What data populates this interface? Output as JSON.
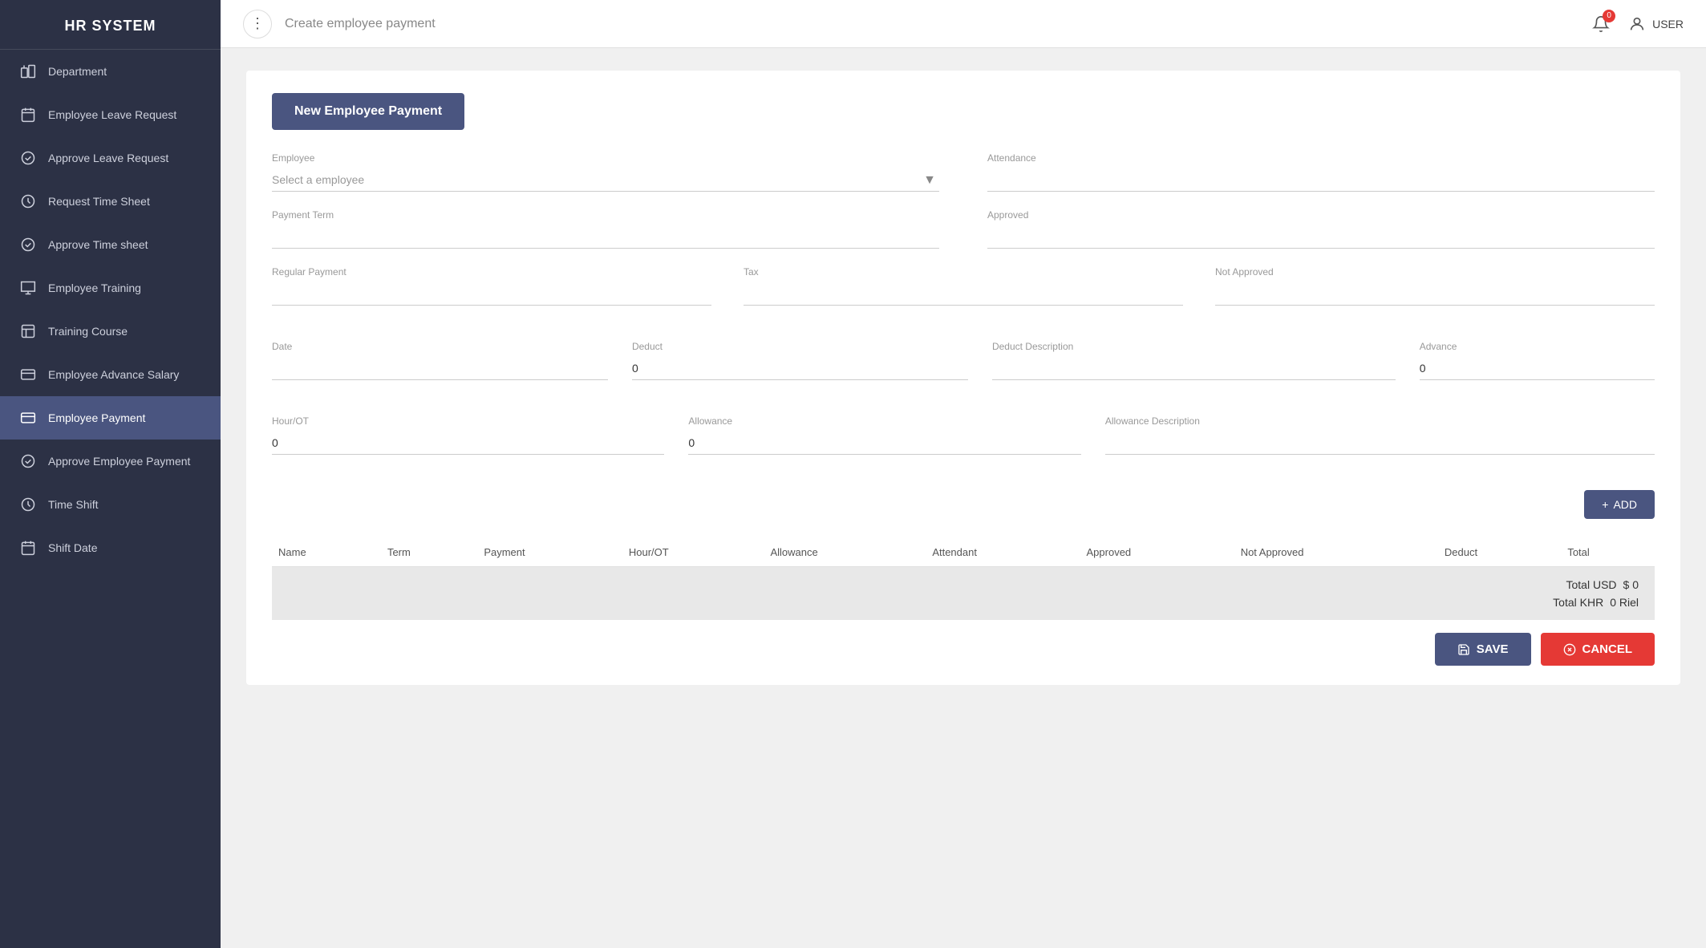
{
  "app": {
    "title": "HR SYSTEM"
  },
  "topbar": {
    "page_title": "Create employee payment",
    "notification_count": "0",
    "user_label": "USER"
  },
  "sidebar": {
    "items": [
      {
        "id": "department",
        "label": "Department",
        "icon": "department-icon",
        "active": false
      },
      {
        "id": "employee-leave-request",
        "label": "Employee Leave Request",
        "icon": "leave-icon",
        "active": false
      },
      {
        "id": "approve-leave-request",
        "label": "Approve Leave Request",
        "icon": "approve-icon",
        "active": false
      },
      {
        "id": "request-time-sheet",
        "label": "Request Time Sheet",
        "icon": "clock-icon",
        "active": false
      },
      {
        "id": "approve-time-sheet",
        "label": "Approve Time sheet",
        "icon": "approve2-icon",
        "active": false
      },
      {
        "id": "employee-training",
        "label": "Employee Training",
        "icon": "training-icon",
        "active": false
      },
      {
        "id": "training-course",
        "label": "Training Course",
        "icon": "course-icon",
        "active": false
      },
      {
        "id": "employee-advance-salary",
        "label": "Employee Advance Salary",
        "icon": "salary-icon",
        "active": false
      },
      {
        "id": "employee-payment",
        "label": "Employee Payment",
        "icon": "payment-icon",
        "active": true
      },
      {
        "id": "approve-employee-payment",
        "label": "Approve Employee Payment",
        "icon": "approve3-icon",
        "active": false
      },
      {
        "id": "time-shift",
        "label": "Time Shift",
        "icon": "timeshift-icon",
        "active": false
      },
      {
        "id": "shift-date",
        "label": "Shift Date",
        "icon": "shiftdate-icon",
        "active": false
      }
    ]
  },
  "form": {
    "header_btn": "New Employee Payment",
    "employee_label": "Employee",
    "employee_placeholder": "Select a employee",
    "attendance_label": "Attendance",
    "attendance_value": "",
    "payment_term_label": "Payment Term",
    "payment_term_value": "",
    "approved_label": "Approved",
    "approved_value": "",
    "regular_payment_label": "Regular Payment",
    "regular_payment_value": "",
    "tax_label": "Tax",
    "tax_value": "",
    "not_approved_label": "Not Approved",
    "not_approved_value": "",
    "date_label": "Date",
    "date_value": "",
    "deduct_label": "Deduct",
    "deduct_value": "0",
    "deduct_desc_label": "Deduct Description",
    "deduct_desc_value": "",
    "advance_label": "Advance",
    "advance_value": "0",
    "hour_ot_label": "Hour/OT",
    "hour_ot_value": "0",
    "allowance_label": "Allowance",
    "allowance_value": "0",
    "allowance_desc_label": "Allowance Description",
    "allowance_desc_value": ""
  },
  "add_btn": "+ ADD",
  "table": {
    "columns": [
      "Name",
      "Term",
      "Payment",
      "Hour/OT",
      "Allowance",
      "Attendant",
      "Approved",
      "Not Approved",
      "Deduct",
      "Total"
    ],
    "rows": [],
    "total_usd_label": "Total USD",
    "total_usd_value": "$ 0",
    "total_khr_label": "Total KHR",
    "total_khr_value": "0 Riel"
  },
  "actions": {
    "save_label": "SAVE",
    "cancel_label": "CANCEL"
  }
}
